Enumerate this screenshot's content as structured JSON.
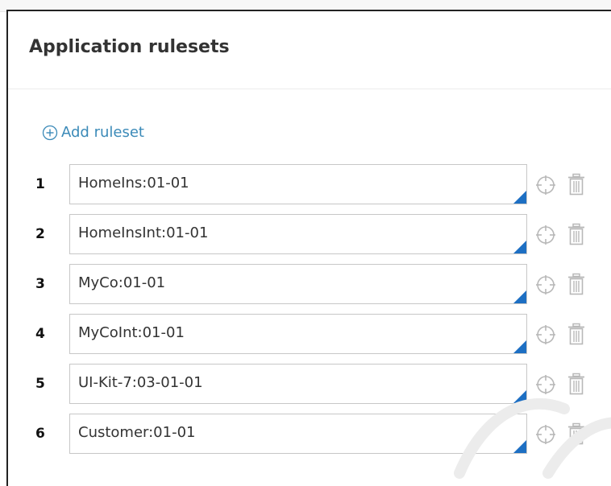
{
  "panel": {
    "title": "Application rulesets",
    "add_label": "Add ruleset"
  },
  "rulesets": [
    {
      "index": "1",
      "value": "HomeIns:01-01"
    },
    {
      "index": "2",
      "value": "HomeInsInt:01-01"
    },
    {
      "index": "3",
      "value": "MyCo:01-01"
    },
    {
      "index": "4",
      "value": "MyCoInt:01-01"
    },
    {
      "index": "5",
      "value": "UI-Kit-7:03-01-01"
    },
    {
      "index": "6",
      "value": "Customer:01-01"
    }
  ],
  "icons": {
    "add": "plus-circle-icon",
    "locate": "crosshair-icon",
    "delete": "trash-icon",
    "dropdown": "dropdown-corner-icon"
  },
  "colors": {
    "accent": "#3b8ab8",
    "corner": "#1d6fc3",
    "icon_gray": "#b8b8b8"
  }
}
